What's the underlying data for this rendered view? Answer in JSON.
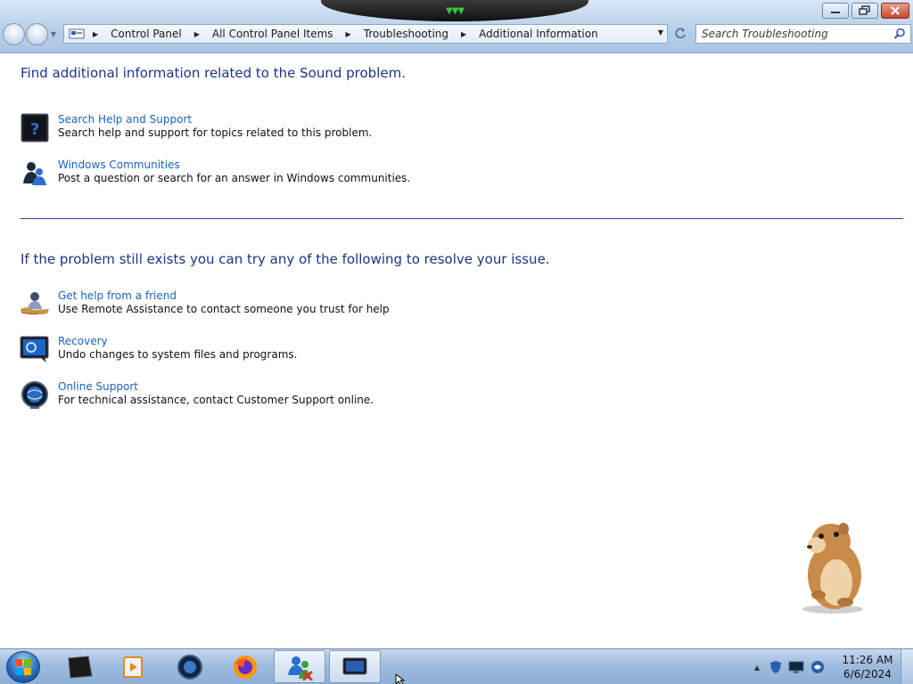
{
  "window": {
    "minimize_label": "Minimize",
    "maximize_label": "Maximize",
    "close_label": "Close"
  },
  "breadcrumb": {
    "items": [
      "Control Panel",
      "All Control Panel Items",
      "Troubleshooting",
      "Additional Information"
    ]
  },
  "search": {
    "placeholder": "Search Troubleshooting"
  },
  "content": {
    "section1_heading": "Find additional information related to the Sound problem.",
    "section2_heading": "If the problem still exists you can try any of the following to resolve your issue.",
    "items": [
      {
        "title": "Search Help and Support",
        "description": "Search help and support for topics related to this problem.",
        "icon": "help-support-icon"
      },
      {
        "title": "Windows Communities",
        "description": "Post a question or search for an answer in Windows communities.",
        "icon": "communities-icon"
      },
      {
        "title": "Get help from a friend",
        "description": "Use Remote Assistance to contact someone you trust for help",
        "icon": "remote-assistance-icon"
      },
      {
        "title": "Recovery",
        "description": "Undo changes to system files and programs.",
        "icon": "recovery-icon"
      },
      {
        "title": "Online Support",
        "description": "For technical assistance, contact Customer Support online.",
        "icon": "online-support-icon"
      }
    ]
  },
  "taskbar": {
    "apps": [
      "start-orb-icon",
      "terminal-icon",
      "media-player-icon",
      "browser-icon",
      "firefox-icon",
      "control-panel-icon",
      "monitor-app-icon"
    ],
    "clock_time": "11:26 AM",
    "clock_date": "6/6/2024"
  },
  "colors": {
    "heading": "#1e3287",
    "link": "#1565c0",
    "divider": "#30408f",
    "taskbar": "#9fbcdd"
  }
}
